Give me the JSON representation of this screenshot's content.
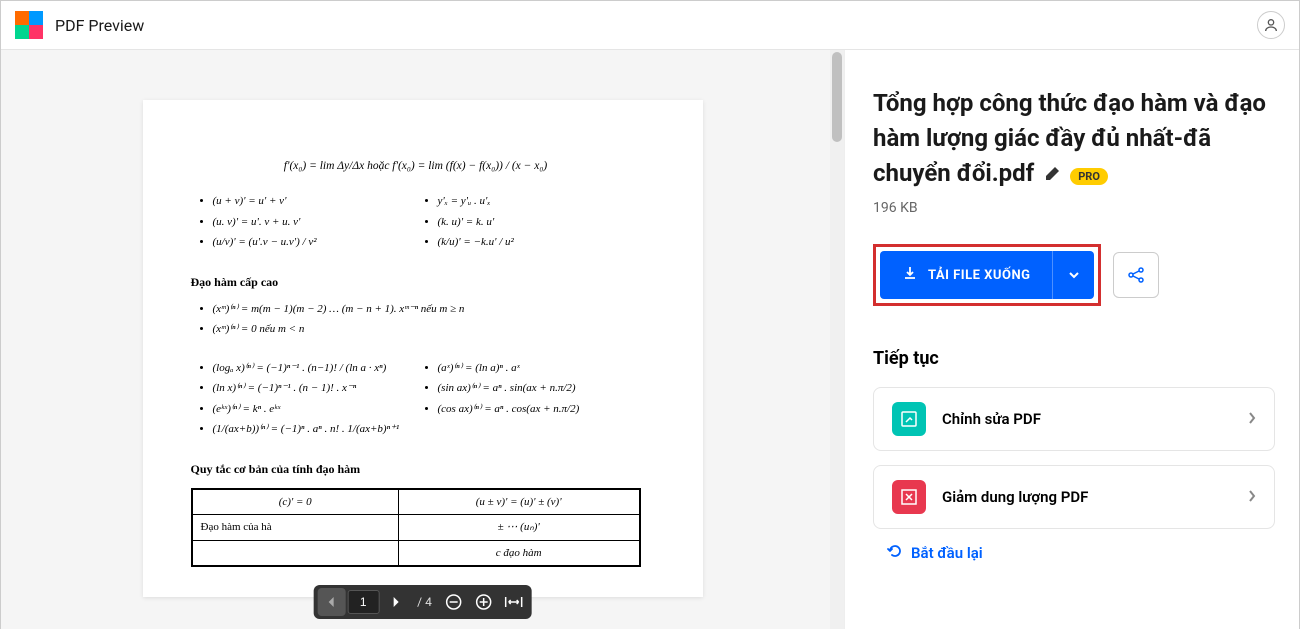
{
  "header": {
    "title": "PDF Preview"
  },
  "toolbar": {
    "page_current": "1",
    "page_total": "/ 4"
  },
  "doc": {
    "formula_center": "f'(x₀) = lim Δy/Δx hoặc f'(x₀) = lim (f(x) − f(x₀)) / (x − x₀)",
    "list1_left": [
      "(u + v)' = u' + v'",
      "(u. v)' = u'. v + u. v'",
      "(u/v)' = (u'.v − u.v') / v²"
    ],
    "list1_right": [
      "y'ₓ = y'ᵤ . u'ₓ",
      "(k. u)' = k. u'",
      "(k/u)' = −k.u' / u²"
    ],
    "h1": "Đạo hàm cấp cao",
    "list2": [
      "(xᵐ)⁽ⁿ⁾ = m(m − 1)(m − 2) … (m − n + 1). xᵐ⁻ⁿ nếu m ≥ n",
      "(xᵐ)⁽ⁿ⁾ = 0 nếu m < n"
    ],
    "list3_left": [
      "(logₐ x)⁽ⁿ⁾ = (−1)ⁿ⁻¹ . (n−1)! / (ln a · xⁿ)",
      "(ln x)⁽ⁿ⁾ = (−1)ⁿ⁻¹ . (n − 1)! . x⁻ⁿ",
      "(eᵏˣ)⁽ⁿ⁾ = kⁿ . eᵏˣ",
      "(1/(ax+b))⁽ⁿ⁾ = (−1)ⁿ . aⁿ . n! . 1/(ax+b)ⁿ⁺¹"
    ],
    "list3_right": [
      "(aˣ)⁽ⁿ⁾ = (ln a)ⁿ . aˣ",
      "(sin ax)⁽ⁿ⁾ = aⁿ . sin(ax + n.π/2)",
      "(cos ax)⁽ⁿ⁾ = aⁿ . cos(ax + n.π/2)"
    ],
    "h2": "Quy tắc cơ bản của tính đạo hàm",
    "table": {
      "r1c1": "(c)' = 0",
      "r1c2": "(u ± v)' = (u)' ± (v)'",
      "r2_label": "Đạo hàm của hà",
      "r2c2": "± ⋯ (uₙ)'",
      "r3c2": "c đạo hàm"
    }
  },
  "sidebar": {
    "filename": "Tổng hợp công thức đạo hàm và đạo hàm lượng giác đầy đủ nhất-đã chuyển đổi.pdf",
    "pro": "PRO",
    "size": "196 KB",
    "download": "TẢI FILE XUỐNG",
    "continue": "Tiếp tục",
    "edit": "Chỉnh sửa PDF",
    "compress": "Giảm dung lượng PDF",
    "restart": "Bắt đầu lại"
  }
}
